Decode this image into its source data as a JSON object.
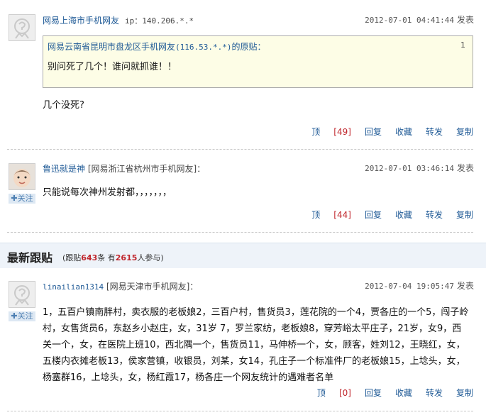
{
  "posts": [
    {
      "author": "网易上海市手机网友",
      "ip": "ip：140.206.*.*",
      "time": "2012-07-01 04:41:44",
      "post_label": "发表",
      "quote": {
        "source_prefix": "网易云南省昆明市盘龙区手机网友",
        "source_ip": "(116.53.*.*)",
        "source_suffix": "的原贴：",
        "floor": "1",
        "text": "别问死了几个！谁问就抓谁！！"
      },
      "text": "几个没死?",
      "actions": {
        "up": "顶",
        "up_count": "[49]",
        "reply": "回复",
        "fav": "收藏",
        "share": "转发",
        "copy": "复制"
      }
    },
    {
      "author": "鲁迅就是神",
      "meta": "[网易浙江省杭州市手机网友]：",
      "follow": "✚关注",
      "time": "2012-07-01 03:46:14",
      "post_label": "发表",
      "text": "只能说每次神州发射都，，，，，，，",
      "actions": {
        "up": "顶",
        "up_count": "[44]",
        "reply": "回复",
        "fav": "收藏",
        "share": "转发",
        "copy": "复制"
      }
    }
  ],
  "section": {
    "title": "最新跟贴",
    "stats_prefix": "(跟贴",
    "post_count": "643",
    "stats_mid": "条 有",
    "people_count": "2615",
    "stats_suffix": "人参与)"
  },
  "latest": {
    "author": "linailian1314",
    "meta": "[网易天津市手机网友]：",
    "follow": "✚关注",
    "time": "2012-07-04 19:05:47",
    "post_label": "发表",
    "text": "1，五百户镇南胖村，卖衣服的老板娘2，三百户村，售货员3，莲花院的一个4，贾各庄的一个5，闯子岭村，女售货员6，东赵乡小赵庄，女，31岁 7，罗兰家纺，老板娘8，穿芳峪太平庄子，21岁，女9，西关一个，女，在医院上班10，西北隅一个，售货员11，马伸桥一个，女，顾客，姓刘12，王晓红，女，五楼内衣摊老板13，侯家营镇，收银员，刘某，女14，孔庄子一个标准件厂的老板娘15，上埝头，女，杨塞群16，上埝头，女，杨红霞17，杨各庄一个网友统计的遇难者名单",
    "actions": {
      "up": "顶",
      "up_count": "[0]",
      "reply": "回复",
      "fav": "收藏",
      "share": "转发",
      "copy": "复制"
    }
  },
  "icons": {
    "default_avatar": "default-avatar-icon",
    "baby_avatar": "baby-avatar-image",
    "follow": "plus-icon"
  },
  "colors": {
    "link": "#1f5a96",
    "highlight": "#c0262c",
    "quote_bg": "#fdfde6",
    "section_bg": "#eef3f9"
  }
}
